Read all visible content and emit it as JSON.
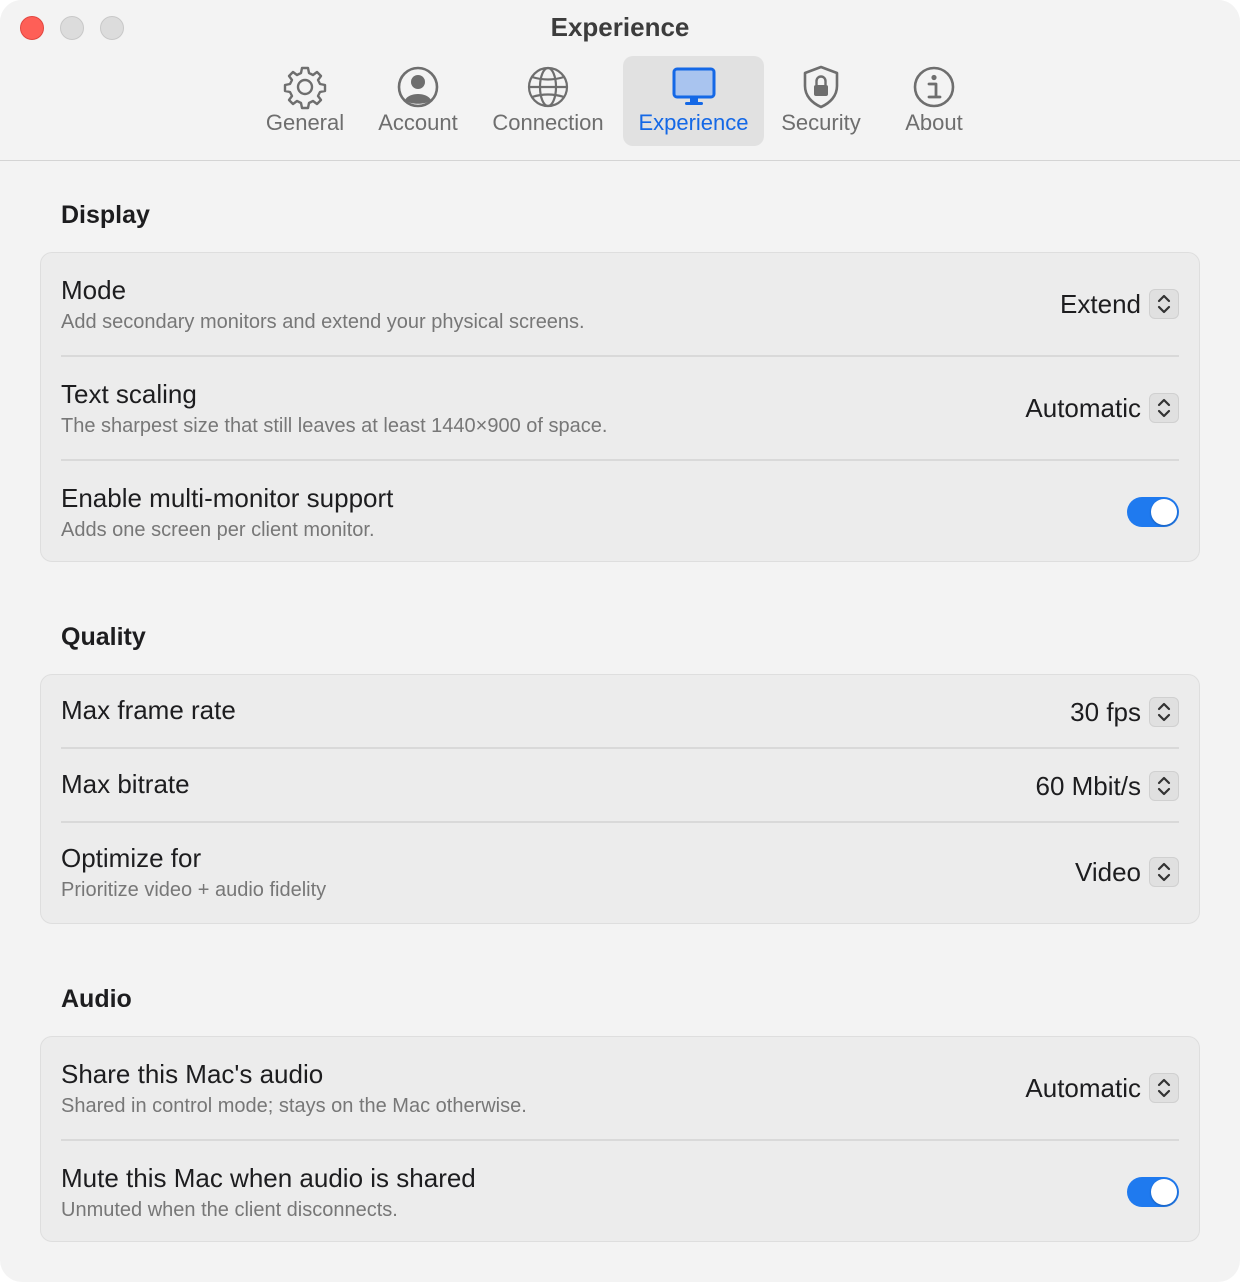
{
  "window": {
    "title": "Experience",
    "accent_color": "#1f7aef"
  },
  "tabs": [
    {
      "label": "General",
      "icon": "gear-icon"
    },
    {
      "label": "Account",
      "icon": "person-circle-icon"
    },
    {
      "label": "Connection",
      "icon": "globe-icon"
    },
    {
      "label": "Experience",
      "icon": "display-icon",
      "active": true
    },
    {
      "label": "Security",
      "icon": "shield-lock-icon"
    },
    {
      "label": "About",
      "icon": "info-circle-icon"
    }
  ],
  "display": {
    "title": "Display",
    "mode": {
      "label": "Mode",
      "description": "Add secondary monitors and extend your physical screens.",
      "value": "Extend"
    },
    "text_scaling": {
      "label": "Text scaling",
      "description": "The sharpest size that still leaves at least 1440×900 of space.",
      "value": "Automatic"
    },
    "multi_monitor": {
      "label": "Enable multi-monitor support",
      "description": "Adds one screen per client monitor.",
      "enabled": true
    }
  },
  "quality": {
    "title": "Quality",
    "max_frame_rate": {
      "label": "Max frame rate",
      "value": "30 fps"
    },
    "max_bitrate": {
      "label": "Max bitrate",
      "value": "60 Mbit/s"
    },
    "optimize_for": {
      "label": "Optimize for",
      "description": "Prioritize video + audio fidelity",
      "value": "Video"
    }
  },
  "audio": {
    "title": "Audio",
    "share_audio": {
      "label": "Share this Mac's audio",
      "description": "Shared in control mode; stays on the Mac otherwise.",
      "value": "Automatic"
    },
    "mute_when_shared": {
      "label": "Mute this Mac when audio is shared",
      "description": "Unmuted when the client disconnects.",
      "enabled": true
    }
  }
}
